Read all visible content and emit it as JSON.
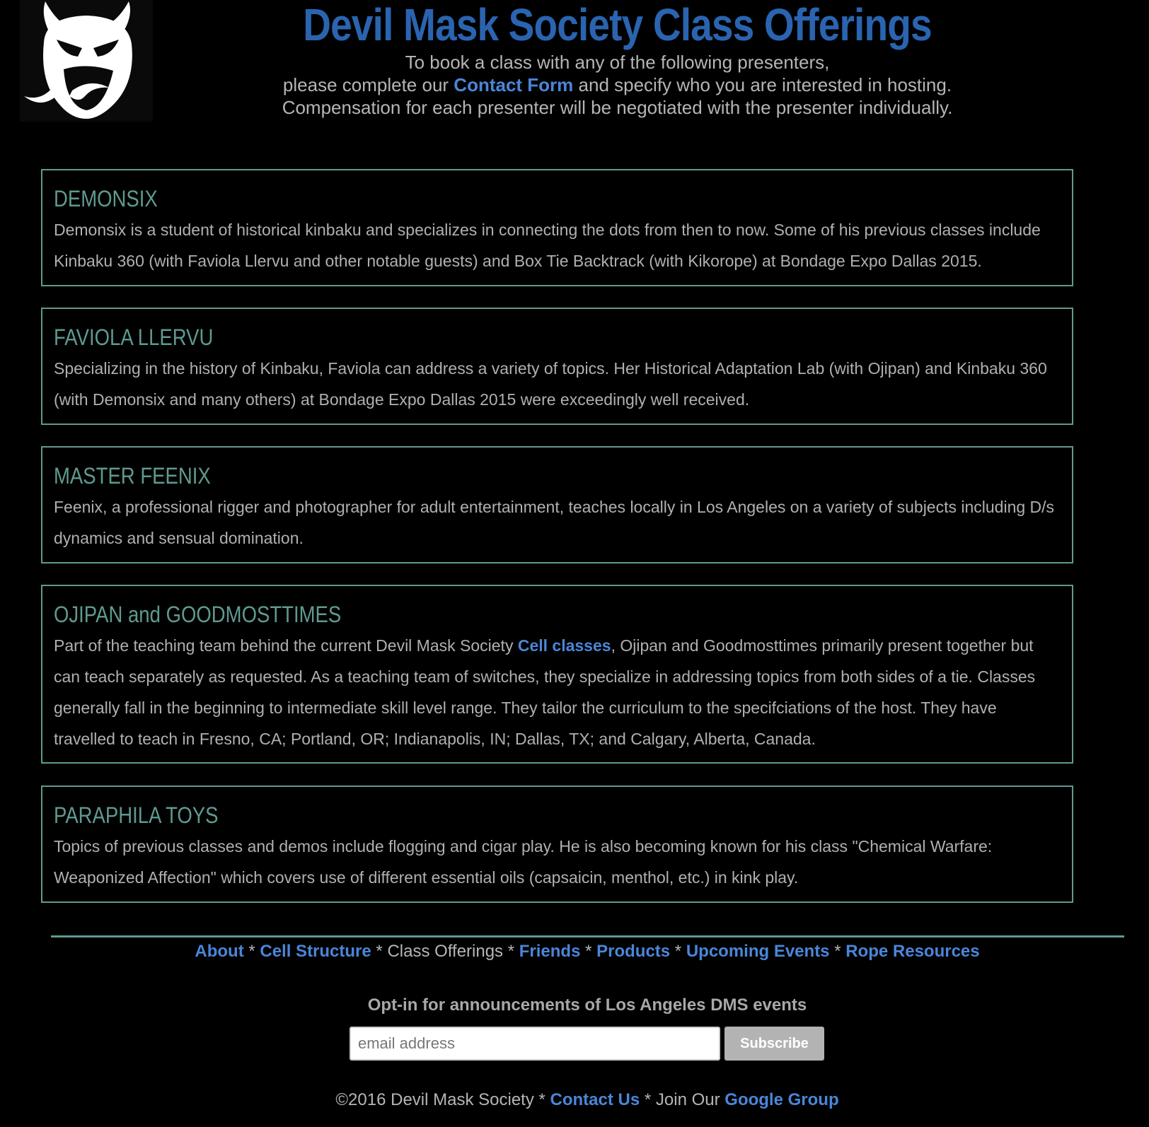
{
  "header": {
    "title": "Devil Mask Society Class Offerings",
    "intro_line1": "To book a class with any of the following presenters,",
    "intro_line2_pre": "please complete our ",
    "contact_form_link": "Contact Form",
    "intro_line2_post": " and specify who you are interested in hosting.",
    "intro_line3": "Compensation for each presenter will be negotiated with the presenter individually."
  },
  "logo": {
    "icon": "devil-mask-icon"
  },
  "presenters": [
    {
      "name": "DEMONSIX",
      "description": "Demonsix is a student of historical kinbaku and specializes in connecting the dots from then to now. Some of his previous classes include Kinbaku 360 (with Faviola Llervu and other notable guests) and Box Tie Backtrack (with Kikorope) at Bondage Expo Dallas 2015."
    },
    {
      "name": "FAVIOLA LLERVU",
      "description": "Specializing in the history of Kinbaku, Faviola can address a variety of topics. Her Historical Adaptation Lab (with Ojipan) and Kinbaku 360 (with Demonsix and many others) at Bondage Expo Dallas 2015 were exceedingly well received."
    },
    {
      "name": "MASTER FEENIX",
      "description": "Feenix, a professional rigger and photographer for adult entertainment, teaches locally in Los Angeles on a variety of subjects including D/s dynamics and sensual domination."
    },
    {
      "name": "OJIPAN and GOODMOSTTIMES",
      "description_pre": "Part of the teaching team behind the current Devil Mask Society ",
      "link": "Cell classes",
      "description_post": ", Ojipan and Goodmosttimes primarily present together but can teach separately as requested. As a teaching team of switches, they specialize in addressing topics from both sides of a tie. Classes generally fall in the beginning to intermediate skill level range. They tailor the curriculum to the specifciations of the host. They have travelled to teach in Fresno, CA; Portland, OR; Indianapolis, IN; Dallas, TX; and Calgary, Alberta, Canada."
    },
    {
      "name": "PARAPHILA TOYS",
      "description": "Topics of previous classes and demos include flogging and cigar play. He is also becoming known for his class \"Chemical Warfare: Weaponized Affection\" which covers use of different essential oils (capsaicin, menthol, etc.) in kink play."
    }
  ],
  "footer": {
    "nav": {
      "about": "About",
      "cell_structure": "Cell Structure",
      "class_offerings": "Class Offerings",
      "friends": "Friends",
      "products": "Products",
      "upcoming_events": "Upcoming Events",
      "rope_resources": "Rope Resources",
      "separator": " * "
    },
    "optin_label": "Opt-in for announcements of Los Angeles DMS events",
    "email_placeholder": "email address",
    "subscribe_label": "Subscribe",
    "copyright": "©2016 Devil Mask Society",
    "contact_us": "Contact Us",
    "join_our": "Join Our ",
    "google_group": "Google Group"
  },
  "colors": {
    "background": "#000000",
    "title_blue": "#2a64b0",
    "link_blue": "#4a86d8",
    "accent_teal": "#5f9a90",
    "text_gray": "#b5b5b5"
  }
}
